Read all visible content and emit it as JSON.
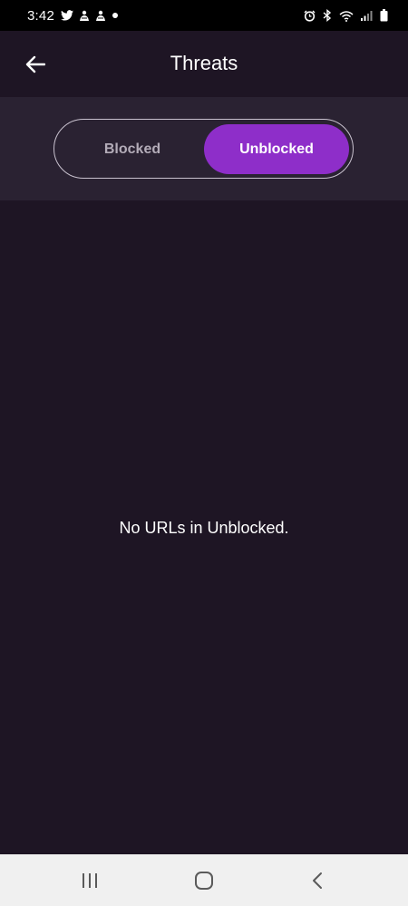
{
  "status_bar": {
    "time": "3:42",
    "left_icons": [
      "twitter-icon",
      "notification-icon",
      "notification-icon",
      "dot-icon"
    ],
    "right_icons": [
      "alarm-icon",
      "bluetooth-icon",
      "wifi-icon",
      "signal-icon",
      "battery-icon"
    ]
  },
  "header": {
    "title": "Threats",
    "back_icon": "arrow-left-icon"
  },
  "toggle": {
    "options": [
      "Blocked",
      "Unblocked"
    ],
    "selected": "Unblocked"
  },
  "content": {
    "empty_message": "No URLs in Unblocked."
  },
  "nav_bar": {
    "buttons": [
      "recent-apps-icon",
      "home-icon",
      "back-icon"
    ]
  },
  "colors": {
    "background": "#1e1524",
    "toggle_section": "#2a2232",
    "accent": "#8e2ec9",
    "status_bar": "#000000",
    "nav_bar": "#f0f0f0"
  }
}
